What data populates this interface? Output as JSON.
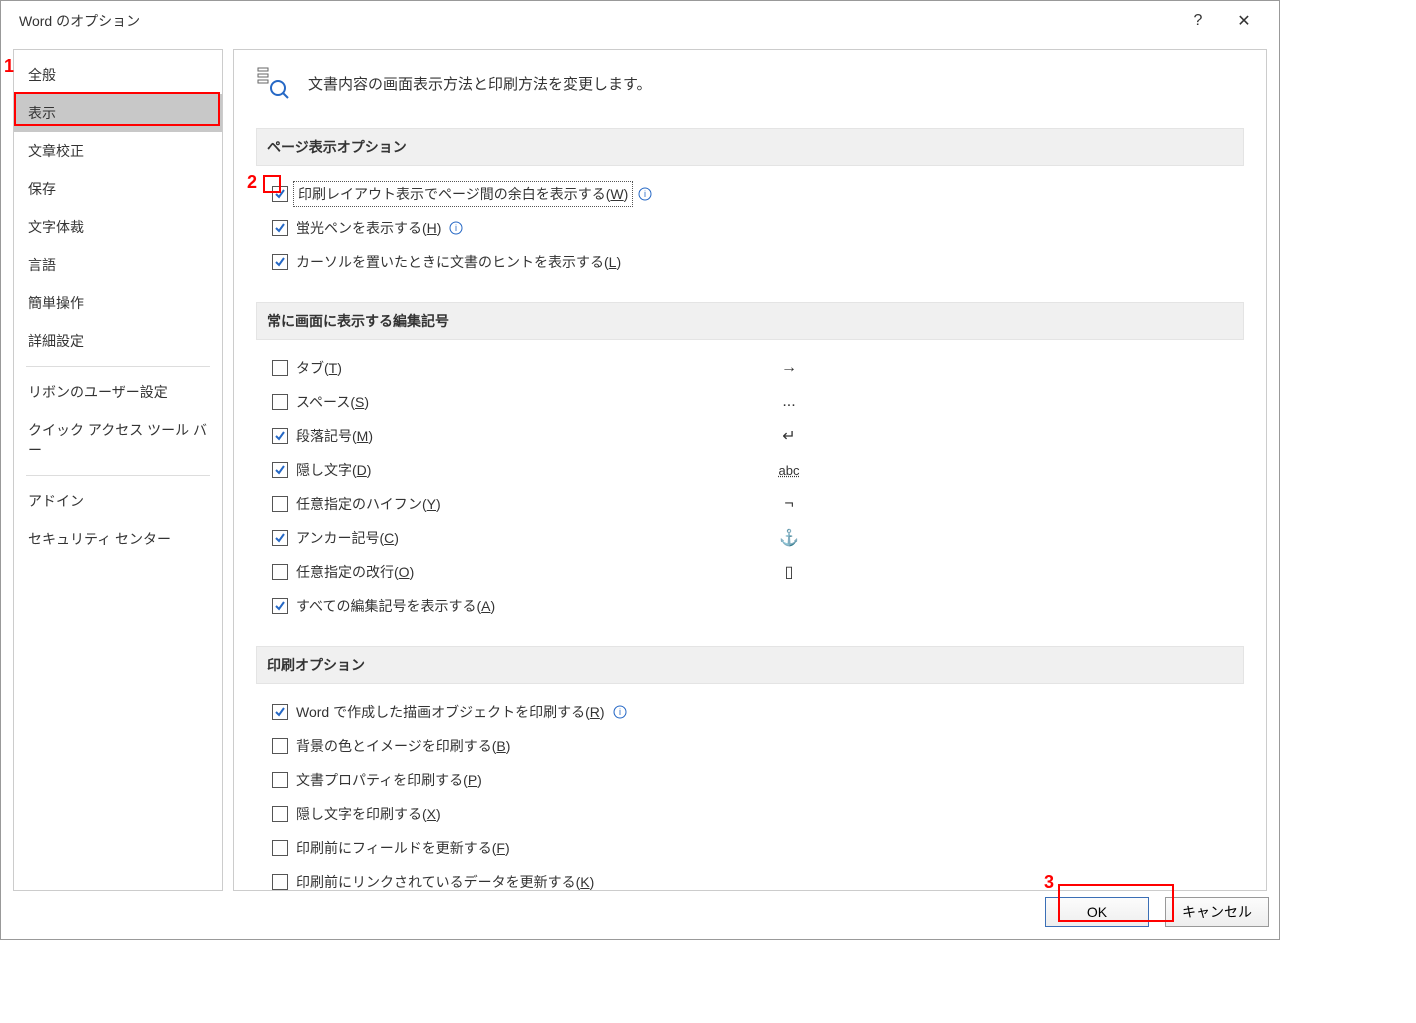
{
  "title": "Word のオプション",
  "titlebar": {
    "help": "?",
    "close": "✕"
  },
  "sidebar": {
    "selectedIndex": 1,
    "groups": [
      [
        "全般",
        "表示",
        "文章校正",
        "保存",
        "文字体裁",
        "言語",
        "簡単操作",
        "詳細設定"
      ],
      [
        "リボンのユーザー設定",
        "クイック アクセス ツール バー"
      ],
      [
        "アドイン",
        "セキュリティ センター"
      ]
    ]
  },
  "header": {
    "text": "文書内容の画面表示方法と印刷方法を変更します。"
  },
  "sections": {
    "page": {
      "title": "ページ表示オプション",
      "items": [
        {
          "label": "印刷レイアウト表示でページ間の余白を表示する(",
          "accel": "W",
          "tail": ")",
          "checked": true,
          "info": true,
          "focused": true
        },
        {
          "label": "蛍光ペンを表示する(",
          "accel": "H",
          "tail": ")",
          "checked": true,
          "info": true
        },
        {
          "label": "カーソルを置いたときに文書のヒントを表示する(",
          "accel": "L",
          "tail": ")",
          "checked": true
        }
      ]
    },
    "marks": {
      "title": "常に画面に表示する編集記号",
      "items": [
        {
          "label": "タブ(",
          "accel": "T",
          "tail": ")",
          "checked": false,
          "symbol": "→"
        },
        {
          "label": "スペース(",
          "accel": "S",
          "tail": ")",
          "checked": false,
          "symbol": "..."
        },
        {
          "label": "段落記号(",
          "accel": "M",
          "tail": ")",
          "checked": true,
          "symbol": "↵"
        },
        {
          "label": "隠し文字(",
          "accel": "D",
          "tail": ")",
          "checked": true,
          "symbol": "abc"
        },
        {
          "label": "任意指定のハイフン(",
          "accel": "Y",
          "tail": ")",
          "checked": false,
          "symbol": "¬"
        },
        {
          "label": "アンカー記号(",
          "accel": "C",
          "tail": ")",
          "checked": true,
          "symbol": "⚓"
        },
        {
          "label": "任意指定の改行(",
          "accel": "O",
          "tail": ")",
          "checked": false,
          "symbol": "▯"
        },
        {
          "label": "すべての編集記号を表示する(",
          "accel": "A",
          "tail": ")",
          "checked": true
        }
      ]
    },
    "print": {
      "title": "印刷オプション",
      "items": [
        {
          "label": "Word で作成した描画オブジェクトを印刷する(",
          "accel": "R",
          "tail": ")",
          "checked": true,
          "info": true
        },
        {
          "label": "背景の色とイメージを印刷する(",
          "accel": "B",
          "tail": ")",
          "checked": false
        },
        {
          "label": "文書プロパティを印刷する(",
          "accel": "P",
          "tail": ")",
          "checked": false
        },
        {
          "label": "隠し文字を印刷する(",
          "accel": "X",
          "tail": ")",
          "checked": false
        },
        {
          "label": "印刷前にフィールドを更新する(",
          "accel": "F",
          "tail": ")",
          "checked": false
        },
        {
          "label": "印刷前にリンクされているデータを更新する(",
          "accel": "K",
          "tail": ")",
          "checked": false
        }
      ]
    }
  },
  "footer": {
    "ok": "OK",
    "cancel": "キャンセル"
  },
  "annotations": {
    "a1": "1",
    "a2": "2",
    "a3": "3"
  }
}
